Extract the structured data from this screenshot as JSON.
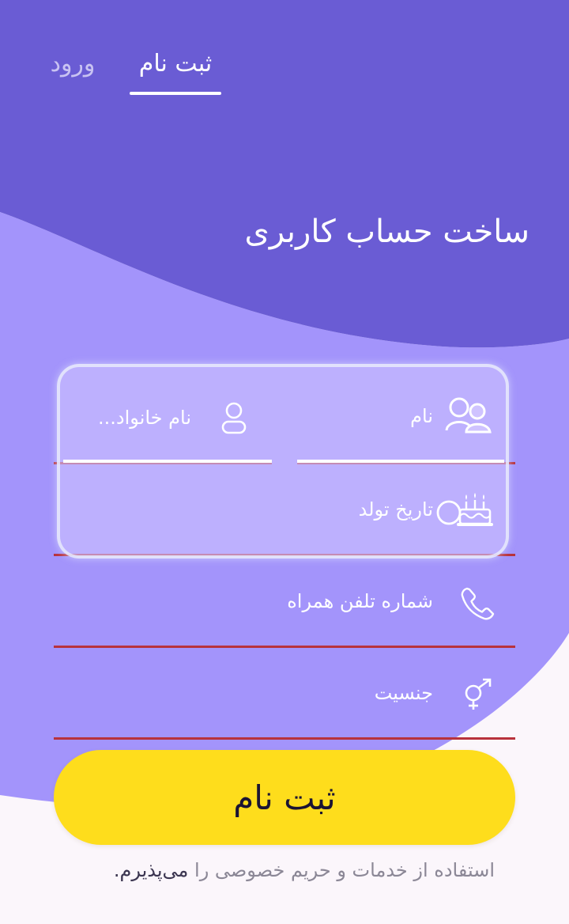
{
  "tabs": {
    "register": "ثبت نام",
    "login": "ورود"
  },
  "title": "ساخت حساب کاربری",
  "form": {
    "first_name": "نام",
    "last_name": "نام خانواد...",
    "birth_date": "تاریخ تولد",
    "phone": "شماره تلفن همراه",
    "gender": "جنسیت"
  },
  "submit_label": "ثبت نام",
  "terms": {
    "prefix": "استفاده از خدمات و حریم خصوصی را",
    "accept": "می‌پذیرم",
    "suffix": "."
  },
  "colors": {
    "header_purple": "#6a5cd4",
    "body_purple": "#a394fb",
    "button_yellow": "#fedd1c",
    "underline_red": "#b8323c",
    "background": "#fbf6fb"
  }
}
